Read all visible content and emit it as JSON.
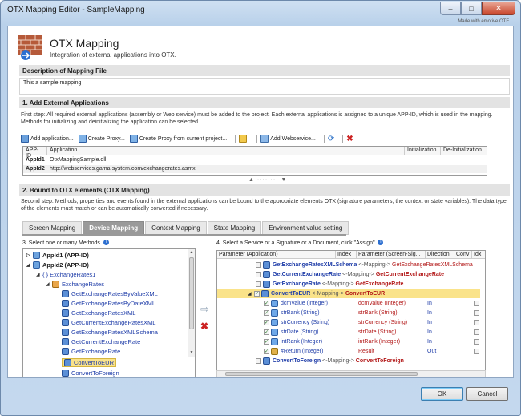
{
  "window": {
    "title": "OTX Mapping Editor - SampleMapping",
    "made_with": "Made with emotive OTF",
    "min": "–",
    "max": "□",
    "close": "✕"
  },
  "header": {
    "title": "OTX Mapping",
    "subtitle": "Integration of external applications into OTX."
  },
  "description": {
    "heading": "Description of Mapping File",
    "text": "This a sample mapping"
  },
  "section1": {
    "heading": "1. Add External Applications",
    "text": "First step: All required external applications (assembly or Web service) must be added to the project. Each external applications is assigned to a unique APP-ID, which is used in the mapping. Methods for initializing and deinitializing the application can be selected.",
    "toolbar": {
      "add_application": "Add application...",
      "create_proxy": "Create Proxy...",
      "create_proxy_current": "Create Proxy from current project...",
      "add_webservice": "Add Webservice..."
    },
    "table": {
      "columns": [
        "APP-ID",
        "Application",
        "Initialization",
        "De-Initialization"
      ],
      "rows": [
        {
          "id": "AppId1",
          "app": "OtxMappingSample.dll"
        },
        {
          "id": "AppId2",
          "app": "http://webservices.gama-system.com/exchangerates.asmx"
        }
      ]
    }
  },
  "splitter": "▲ ········ ▼",
  "section2": {
    "heading": "2. Bound to OTX elements (OTX Mapping)",
    "text": "Second step: Methods, properties and events found in the external applications can be bound to the appropriate elements OTX (signature parameters, the context or state variables). The data type of the elements must match or can be automatically converted if necessary.",
    "tabs": [
      "Screen Mapping",
      "Device Mapping",
      "Context Mapping",
      "State Mapping",
      "Environment value setting"
    ],
    "active_tab": "Device Mapping",
    "left_label": "3. Select one or many Methods.",
    "right_label": "4. Select a Service or a Signature or a Document, click \"Assign\".",
    "tree": [
      {
        "label": "AppId1 (APP-ID)",
        "exp": "▷"
      },
      {
        "label": "AppId2 (APP-ID)",
        "exp": "◢"
      },
      {
        "label": "{ } ExchangeRates1",
        "exp": "◢"
      },
      {
        "label": "ExchangeRates",
        "exp": "◢"
      },
      {
        "label": "GetExchangeRatesByValueXML"
      },
      {
        "label": "GetExchangeRatesByDateXML"
      },
      {
        "label": "GetExchangeRatesXML"
      },
      {
        "label": "GetCurrentExchangeRatesXML"
      },
      {
        "label": "GetExchangeRatesXMLSchema"
      },
      {
        "label": "GetCurrentExchangeRate"
      },
      {
        "label": "GetExchangeRate"
      },
      {
        "label": "ConvertToEUR"
      },
      {
        "label": "ConvertToForeign"
      }
    ],
    "grid": {
      "columns": [
        "Parameter (Application)",
        "Index",
        "Parameter (Screen-Sig...",
        "Direction",
        "Conv",
        "Idx"
      ],
      "mapping_text": "<-Mapping->",
      "rows": [
        {
          "left": "GetExchangeRatesXMLSchema",
          "right": "GetExchangeRatesXMLSchema"
        },
        {
          "left": "GetCurrentExchangeRate",
          "right": "GetCurrentExchangeRate"
        },
        {
          "left": "GetExchangeRate",
          "right": "GetExchangeRate"
        },
        {
          "left": "ConvertToEUR",
          "right": "ConvertToEUR"
        },
        {
          "param": "dcmValue (Integer)",
          "sig": "dcmValue (Integer)",
          "dir": "In"
        },
        {
          "param": "strBank (String)",
          "sig": "strBank (String)",
          "dir": "In"
        },
        {
          "param": "strCurrency (String)",
          "sig": "strCurrency (String)",
          "dir": "In"
        },
        {
          "param": "strDate (String)",
          "sig": "strDate (String)",
          "dir": "In"
        },
        {
          "param": "intRank (Integer)",
          "sig": "intRank (Integer)",
          "dir": "In"
        },
        {
          "param": "#Return (Integer)",
          "sig": "Result",
          "dir": "Out"
        },
        {
          "left": "ConvertToForeign",
          "right": "ConvertToForeign"
        }
      ]
    }
  },
  "buttons": {
    "ok": "OK",
    "cancel": "Cancel"
  }
}
